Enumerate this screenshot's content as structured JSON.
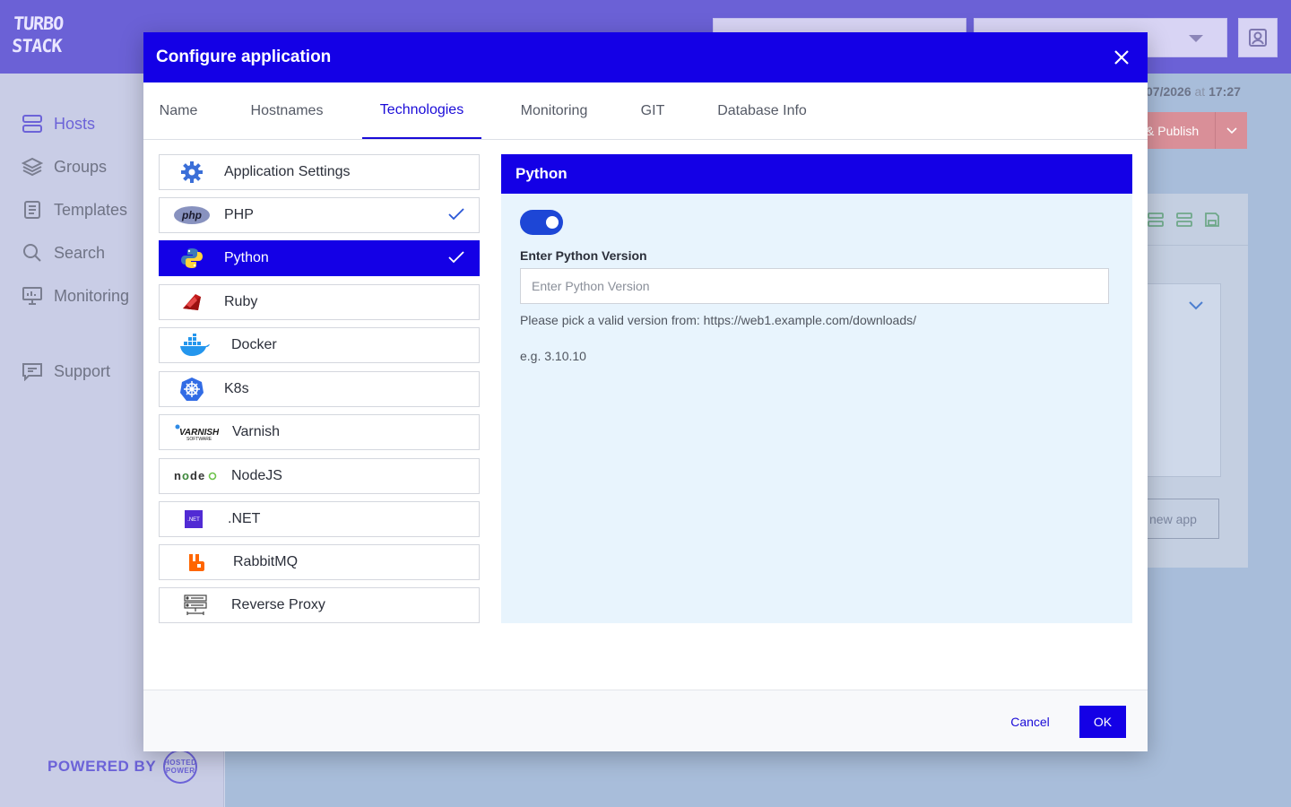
{
  "app": {
    "logo_text": "TURBO STACK",
    "saved_text": "07/2026",
    "saved_at": "at",
    "saved_time": "17:27",
    "publish_label": "& Publish",
    "add_app_label": "l new app"
  },
  "sidebar": {
    "items": [
      {
        "label": "Hosts",
        "icon": "server-icon",
        "active": true
      },
      {
        "label": "Groups",
        "icon": "layers-icon"
      },
      {
        "label": "Templates",
        "icon": "document-icon"
      },
      {
        "label": "Search",
        "icon": "search-icon"
      },
      {
        "label": "Monitoring",
        "icon": "monitor-icon"
      },
      {
        "label": "Support",
        "icon": "support-icon"
      }
    ],
    "powered_by": "POWERED BY",
    "powered_logo": "HOSTED POWER"
  },
  "modal": {
    "title": "Configure application",
    "tabs": [
      {
        "label": "Name"
      },
      {
        "label": "Hostnames"
      },
      {
        "label": "Technologies",
        "active": true
      },
      {
        "label": "Monitoring"
      },
      {
        "label": "GIT"
      },
      {
        "label": "Database Info"
      }
    ],
    "technologies": [
      {
        "label": "Application Settings",
        "icon": "gear-icon",
        "checked": false
      },
      {
        "label": "PHP",
        "icon": "php-icon",
        "checked": true
      },
      {
        "label": "Python",
        "icon": "python-icon",
        "checked": true,
        "active": true
      },
      {
        "label": "Ruby",
        "icon": "ruby-icon",
        "checked": false
      },
      {
        "label": "Docker",
        "icon": "docker-icon",
        "checked": false
      },
      {
        "label": "K8s",
        "icon": "kubernetes-icon",
        "checked": false
      },
      {
        "label": "Varnish",
        "icon": "varnish-icon",
        "checked": false
      },
      {
        "label": "NodeJS",
        "icon": "nodejs-icon",
        "checked": false
      },
      {
        "label": ".NET",
        "icon": "dotnet-icon",
        "checked": false
      },
      {
        "label": "RabbitMQ",
        "icon": "rabbitmq-icon",
        "checked": false
      },
      {
        "label": "Reverse Proxy",
        "icon": "reverse-proxy-icon",
        "checked": false
      }
    ],
    "panel": {
      "title": "Python",
      "enabled": true,
      "version_label": "Enter Python Version",
      "version_placeholder": "Enter Python Version",
      "version_value": "",
      "hint": "Please pick a valid version from: https://web1.example.com/downloads/",
      "example": "e.g. 3.10.10"
    },
    "footer": {
      "cancel_label": "Cancel",
      "ok_label": "OK"
    }
  },
  "colors": {
    "primary": "#1400e6",
    "topbar": "#6b61d6",
    "panel_bg": "#e8f4fd",
    "toggle_on": "#1d46d6"
  }
}
